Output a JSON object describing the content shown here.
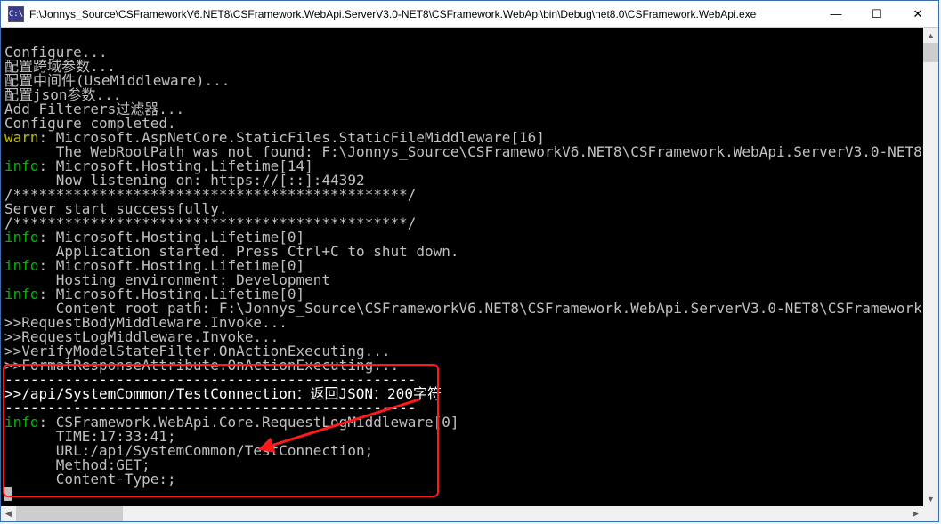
{
  "window": {
    "icon_text": "C:\\",
    "title": "F:\\Jonnys_Source\\CSFrameworkV6.NET8\\CSFramework.WebApi.ServerV3.0-NET8\\CSFramework.WebApi\\bin\\Debug\\net8.0\\CSFramework.WebApi.exe",
    "min": "—",
    "max": "☐",
    "close": "✕"
  },
  "log": {
    "l01": "Configure...",
    "l02": "配置跨域参数...",
    "l03": "配置中间件(UseMiddleware)...",
    "l04": "配置json参数...",
    "l05": "Add Filterers过滤器...",
    "l06": "Configure completed.",
    "l07a": "warn",
    "l07b": ": Microsoft.AspNetCore.StaticFiles.StaticFileMiddleware[16]",
    "l08": "      The WebRootPath was not found: F:\\Jonnys_Source\\CSFrameworkV6.NET8\\CSFramework.WebApi.ServerV3.0-NET8\\CSFramework.WebApi\\wwwroot. Static files may be unavailable.",
    "l10a": "info",
    "l10b": ": Microsoft.Hosting.Lifetime[14]",
    "l11": "      Now listening on: https://[::]:44392",
    "l12": "/**********************************************/",
    "l13": "Server start successfully.",
    "l14": "/**********************************************/",
    "l15a": "info",
    "l15b": ": Microsoft.Hosting.Lifetime[0]",
    "l16": "      Application started. Press Ctrl+C to shut down.",
    "l17a": "info",
    "l17b": ": Microsoft.Hosting.Lifetime[0]",
    "l18": "      Hosting environment: Development",
    "l19a": "info",
    "l19b": ": Microsoft.Hosting.Lifetime[0]",
    "l20": "      Content root path: F:\\Jonnys_Source\\CSFrameworkV6.NET8\\CSFramework.WebApi.ServerV3.0-NET8\\CSFramework.WebApi",
    "l21": ">>RequestBodyMiddleware.Invoke...",
    "l22": ">>RequestLogMiddleware.Invoke...",
    "l23": ">>VerifyModelStateFilter.OnActionExecuting...",
    "l24": ">>FormatResponseAttribute.OnActionExecuting...",
    "l25": "------------------------------------------------",
    "l26": ">>/api/SystemCommon/TestConnection：返回JSON：200字符",
    "l27": "------------------------------------------------",
    "l28a": "info",
    "l28b": ": CSFramework.WebApi.Core.RequestLogMiddleware[0]",
    "l29": "      TIME:17:33:41;",
    "l30": "      URL:/api/SystemCommon/TestConnection;",
    "l31": "      Method:GET;",
    "l32": "      Content-Type:;"
  },
  "scroll": {
    "up": "▲",
    "down": "▼",
    "left": "◀",
    "right": "▶"
  }
}
